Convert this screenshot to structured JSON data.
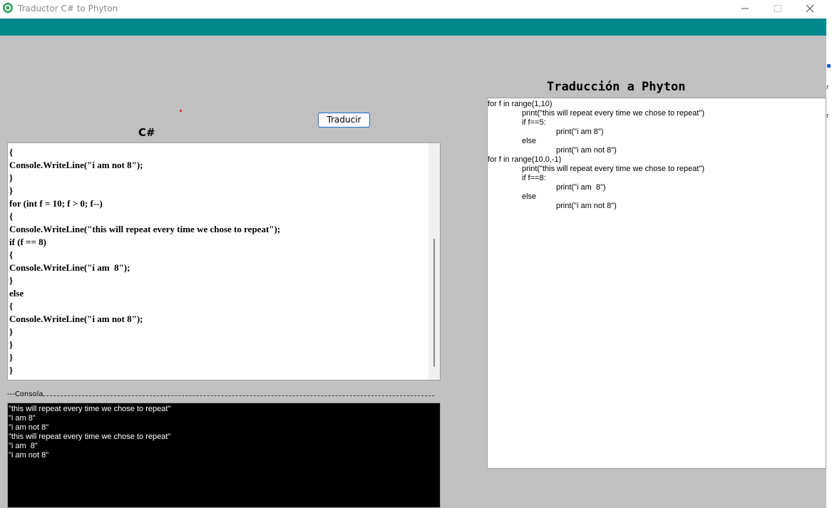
{
  "window": {
    "title": "Traductor C# to Phyton",
    "accent_color": "#00888a",
    "form_bg": "#c0c0c0"
  },
  "icons": {
    "app": "app-logo-icon",
    "minimize": "minimize-icon",
    "maximize": "maximize-icon",
    "close": "close-icon"
  },
  "labels": {
    "csharp_heading": "C#",
    "python_heading": "Traducción a Phyton",
    "translate_button": "Traducir",
    "console_label": "---Consola"
  },
  "csharp_editor": {
    "lines": [
      "{",
      "Console.WriteLine(\"i am not 8\");",
      "}",
      "}",
      "for (int f = 10; f > 0; f--)",
      "{",
      "Console.WriteLine(\"this will repeat every time we chose to repeat\");",
      "if (f == 8)",
      "{",
      "Console.WriteLine(\"i am  8\");",
      "}",
      "else",
      "{",
      "Console.WriteLine(\"i am not 8\");",
      "}",
      "}",
      "}",
      "}"
    ]
  },
  "python_output": {
    "lines": [
      {
        "indent": 0,
        "text": "for f in range(1,10)"
      },
      {
        "indent": 1,
        "text": "print(\"this will repeat every time we chose to repeat\")"
      },
      {
        "indent": 1,
        "text": "if f==5:"
      },
      {
        "indent": 2,
        "text": "print(\"i am 8\")"
      },
      {
        "indent": 1,
        "text": "else"
      },
      {
        "indent": 2,
        "text": "print(\"i am not 8\")"
      },
      {
        "indent": 0,
        "text": "for f in range(10,0,-1)"
      },
      {
        "indent": 1,
        "text": "print(\"this will repeat every time we chose to repeat\")"
      },
      {
        "indent": 1,
        "text": "if f==8:"
      },
      {
        "indent": 2,
        "text": "print(\"i am  8\")"
      },
      {
        "indent": 1,
        "text": "else"
      },
      {
        "indent": 2,
        "text": "print(\"i am not 8\")"
      }
    ]
  },
  "console_output": {
    "lines": [
      "\"this will repeat every time we chose to repeat\"",
      "\"i am 8\"",
      "\"i am not 8\"",
      "\"this will repeat every time we chose to repeat\"",
      "\"i am  8\"",
      "\"i am not 8\""
    ]
  },
  "edge_fragments": [
    "r",
    "r"
  ]
}
